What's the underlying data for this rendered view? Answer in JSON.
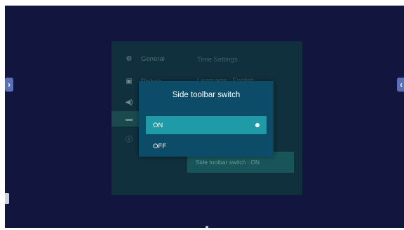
{
  "settings": {
    "menu": [
      {
        "label": "General",
        "icon": "gear-icon",
        "glyph": "⚙"
      },
      {
        "label": "Picture",
        "icon": "picture-icon",
        "glyph": "▣"
      },
      {
        "label": "",
        "icon": "volume-icon",
        "glyph": "◀)"
      },
      {
        "label": "",
        "icon": "display-icon",
        "glyph": "▬"
      },
      {
        "label": "",
        "icon": "info-icon",
        "glyph": "ⓘ"
      }
    ],
    "right_lines": [
      "Time Settings",
      "Language : English"
    ],
    "status_text": "Side toolbar switch : ON"
  },
  "dialog": {
    "title": "Side toolbar switch",
    "options": [
      {
        "label": "ON",
        "selected": true
      },
      {
        "label": "OFF",
        "selected": false
      }
    ]
  },
  "nav": {
    "left_arrow": "›",
    "right_arrow": "‹"
  },
  "colors": {
    "screen_bg": "#12163f",
    "panel_bg": "#10303d",
    "dialog_bg": "#0d4c69",
    "selected_option": "#1f9aa7",
    "status_box": "#17555a"
  }
}
